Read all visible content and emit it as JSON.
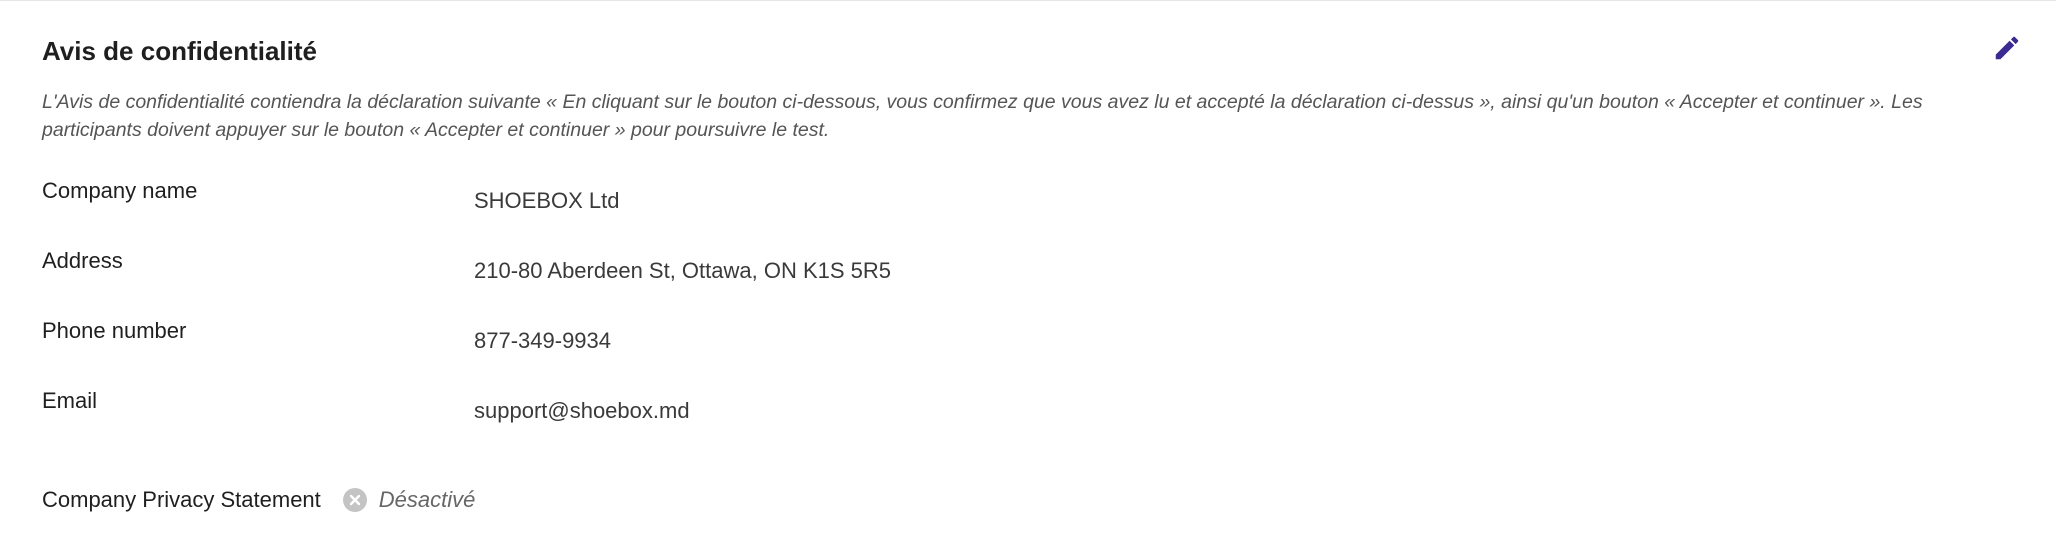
{
  "section": {
    "title": "Avis de confidentialité",
    "description": "L'Avis de confidentialité contiendra la déclaration suivante « En cliquant sur le bouton ci-dessous, vous confirmez que vous avez lu et accepté la déclaration ci-dessus », ainsi qu'un bouton « Accepter et continuer ». Les participants doivent appuyer sur le bouton « Accepter et continuer » pour poursuivre le test.",
    "edit_icon": "pencil-icon",
    "accent_color": "#3b2a8f"
  },
  "fields": [
    {
      "label": "Company name",
      "value": "SHOEBOX Ltd"
    },
    {
      "label": "Address",
      "value": "210-80 Aberdeen St, Ottawa, ON K1S 5R5"
    },
    {
      "label": "Phone number",
      "value": "877-349-9934"
    },
    {
      "label": "Email",
      "value": "support@shoebox.md"
    }
  ],
  "privacy_statement": {
    "label": "Company Privacy Statement",
    "status": "Désactivé",
    "status_icon": "x-circle-icon"
  }
}
